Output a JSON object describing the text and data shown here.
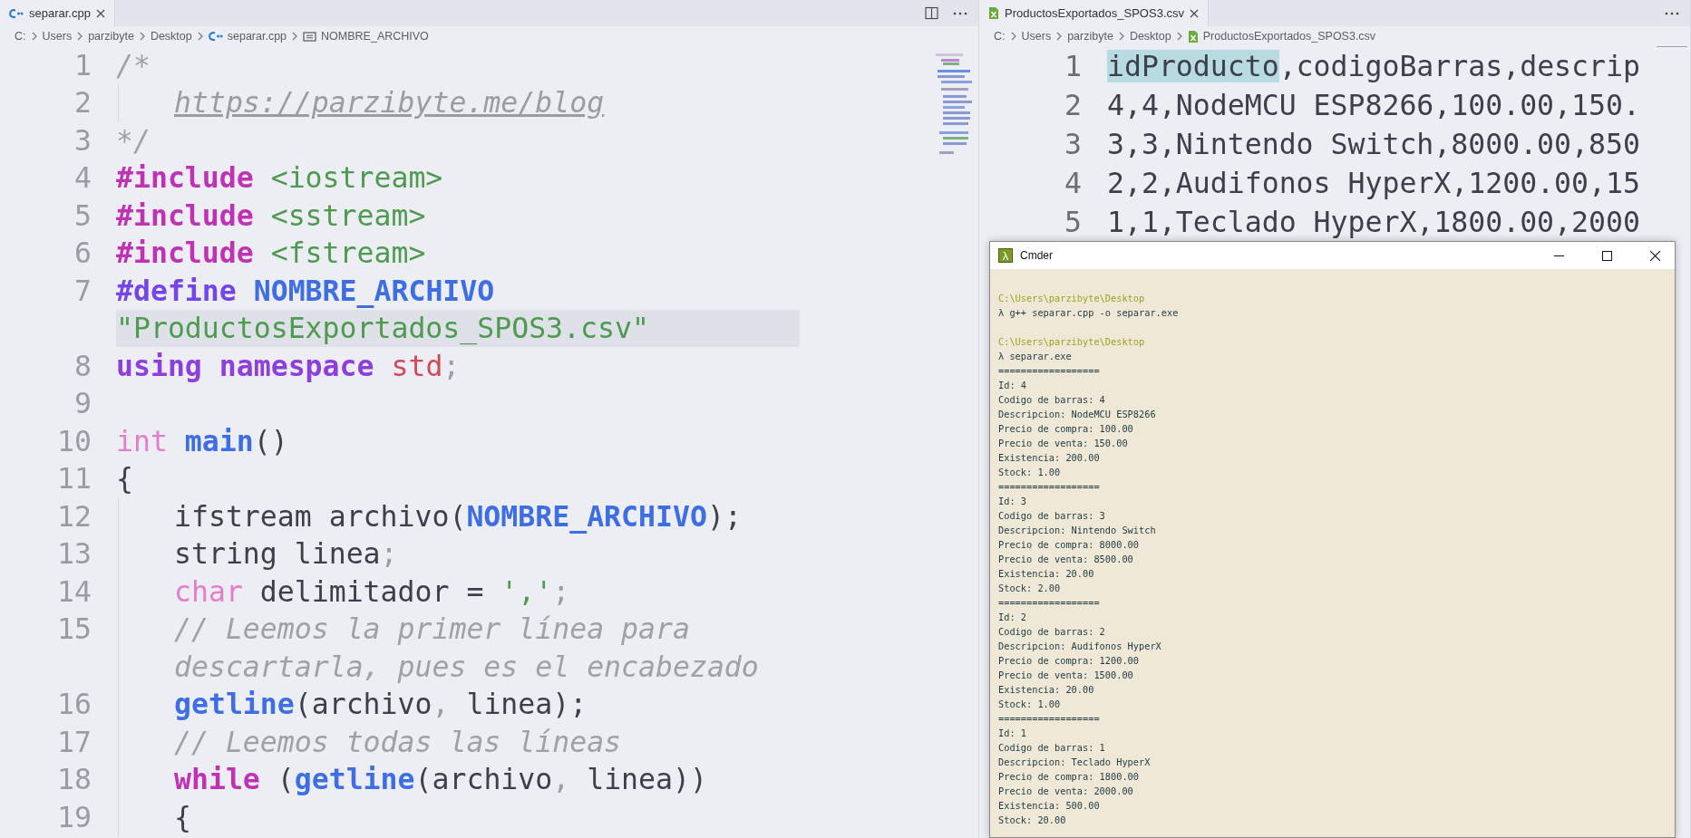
{
  "editor_left": {
    "tab": {
      "label": "separar.cpp",
      "kind": "cpp",
      "selected": true
    },
    "breadcrumb": [
      {
        "text": "C:",
        "kind": "plain"
      },
      {
        "text": "Users",
        "kind": "plain"
      },
      {
        "text": "parzibyte",
        "kind": "plain"
      },
      {
        "text": "Desktop",
        "kind": "plain"
      },
      {
        "text": "separar.cpp",
        "kind": "cpp"
      },
      {
        "text": "NOMBRE_ARCHIVO",
        "kind": "symbol"
      }
    ],
    "code_rows": [
      {
        "number": "1",
        "indented": false,
        "highlighted": false,
        "tokens": [
          {
            "kind": "comment",
            "text": "/*"
          }
        ]
      },
      {
        "number": "2",
        "indented": true,
        "highlighted": false,
        "tokens": [
          {
            "kind": "link",
            "text": "https://parzibyte.me/blog"
          }
        ]
      },
      {
        "number": "3",
        "indented": false,
        "highlighted": false,
        "tokens": [
          {
            "kind": "comment",
            "text": "*/"
          }
        ]
      },
      {
        "number": "4",
        "indented": false,
        "highlighted": false,
        "tokens": [
          {
            "kind": "directive",
            "text": "#include"
          },
          {
            "kind": "header",
            "text": " <iostream>"
          }
        ]
      },
      {
        "number": "5",
        "indented": false,
        "highlighted": false,
        "tokens": [
          {
            "kind": "directive",
            "text": "#include"
          },
          {
            "kind": "header",
            "text": " <sstream>"
          }
        ]
      },
      {
        "number": "6",
        "indented": false,
        "highlighted": false,
        "tokens": [
          {
            "kind": "directive",
            "text": "#include"
          },
          {
            "kind": "header",
            "text": " <fstream>"
          }
        ]
      },
      {
        "number": "7",
        "indented": false,
        "highlighted": false,
        "tokens": [
          {
            "kind": "define",
            "text": "#define"
          },
          {
            "kind": "macro",
            "text": " NOMBRE_ARCHIVO"
          }
        ]
      },
      {
        "indented": false,
        "highlighted": true,
        "tokens": [
          {
            "kind": "string",
            "text": "\"ProductosExportados_SPOS3.csv\""
          }
        ]
      },
      {
        "number": "8",
        "indented": false,
        "highlighted": false,
        "tokens": [
          {
            "kind": "keyword",
            "text": "using namespace"
          },
          {
            "kind": "namespace",
            "text": " std"
          },
          {
            "kind": "punct",
            "text": ";"
          }
        ]
      },
      {
        "number": "9",
        "indented": false,
        "highlighted": false
      },
      {
        "number": "10",
        "indented": false,
        "highlighted": false,
        "tokens": [
          {
            "kind": "type",
            "text": "int"
          },
          {
            "kind": "function",
            "text": " main"
          },
          {
            "kind": "plain",
            "text": "()"
          }
        ]
      },
      {
        "number": "11",
        "indented": false,
        "highlighted": false,
        "tokens": [
          {
            "kind": "plain",
            "text": "{"
          }
        ]
      },
      {
        "number": "12",
        "indented": true,
        "highlighted": false,
        "tokens": [
          {
            "kind": "plain",
            "text": "ifstream archivo("
          },
          {
            "kind": "macro",
            "text": "NOMBRE_ARCHIVO"
          },
          {
            "kind": "plain",
            "text": ");"
          }
        ]
      },
      {
        "number": "13",
        "indented": true,
        "highlighted": false,
        "tokens": [
          {
            "kind": "plain",
            "text": "string linea"
          },
          {
            "kind": "punct",
            "text": ";"
          }
        ]
      },
      {
        "number": "14",
        "indented": true,
        "highlighted": false,
        "tokens": [
          {
            "kind": "type",
            "text": "char"
          },
          {
            "kind": "plain",
            "text": " delimitador = "
          },
          {
            "kind": "string",
            "text": "','"
          },
          {
            "kind": "punct",
            "text": ";"
          }
        ]
      },
      {
        "number": "15",
        "indented": true,
        "highlighted": false,
        "tokens": [
          {
            "kind": "comment",
            "text": "// Leemos la primer línea para"
          }
        ]
      },
      {
        "indented": true,
        "highlighted": false,
        "tokens": [
          {
            "kind": "comment",
            "text": "descartarla, pues es el encabezado"
          }
        ]
      },
      {
        "number": "16",
        "indented": true,
        "highlighted": false,
        "tokens": [
          {
            "kind": "function",
            "text": "getline"
          },
          {
            "kind": "plain",
            "text": "(archivo"
          },
          {
            "kind": "punct",
            "text": ","
          },
          {
            "kind": "plain",
            "text": " linea);"
          }
        ]
      },
      {
        "number": "17",
        "indented": true,
        "highlighted": false,
        "tokens": [
          {
            "kind": "comment",
            "text": "// Leemos todas las líneas"
          }
        ]
      },
      {
        "number": "18",
        "indented": true,
        "highlighted": false,
        "tokens": [
          {
            "kind": "control",
            "text": "while"
          },
          {
            "kind": "plain",
            "text": " ("
          },
          {
            "kind": "function",
            "text": "getline"
          },
          {
            "kind": "plain",
            "text": "(archivo"
          },
          {
            "kind": "punct",
            "text": ","
          },
          {
            "kind": "plain",
            "text": " linea))"
          }
        ]
      },
      {
        "number": "19",
        "indented": true,
        "highlighted": false,
        "tokens": [
          {
            "kind": "plain",
            "text": "{"
          }
        ]
      }
    ]
  },
  "editor_right": {
    "tab": {
      "label": "ProductosExportados_SPOS3.csv",
      "kind": "csv",
      "selected": true
    },
    "breadcrumb": [
      {
        "text": "C:",
        "kind": "plain"
      },
      {
        "text": "Users",
        "kind": "plain"
      },
      {
        "text": "parzibyte",
        "kind": "plain"
      },
      {
        "text": "Desktop",
        "kind": "plain"
      },
      {
        "text": "ProductosExportados_SPOS3.csv",
        "kind": "csv"
      }
    ],
    "csv_rows": [
      {
        "number": "1",
        "parts": [
          {
            "text": "idProducto",
            "highlighted": true
          },
          {
            "text": ",codigoBarras,descrip",
            "highlighted": false
          }
        ]
      },
      {
        "number": "2",
        "parts": [
          {
            "text": "4,4,NodeMCU ESP8266,100.00,150.",
            "highlighted": false
          }
        ]
      },
      {
        "number": "3",
        "parts": [
          {
            "text": "3,3,Nintendo Switch,8000.00,850",
            "highlighted": false
          }
        ]
      },
      {
        "number": "4",
        "parts": [
          {
            "text": "2,2,Audifonos HyperX,1200.00,15",
            "highlighted": false
          }
        ]
      },
      {
        "number": "5",
        "parts": [
          {
            "text": "1,1,Teclado HyperX,1800.00,2000",
            "highlighted": false
          }
        ]
      }
    ]
  },
  "terminal": {
    "icon": "λ",
    "title": "Cmder",
    "lines": [
      {
        "kind": "blank"
      },
      {
        "kind": "path",
        "text": "C:\\Users\\parzibyte\\Desktop"
      },
      {
        "kind": "output",
        "text": "λ g++ separar.cpp -o separar.exe"
      },
      {
        "kind": "blank"
      },
      {
        "kind": "path",
        "text": "C:\\Users\\parzibyte\\Desktop"
      },
      {
        "kind": "output",
        "text": "λ separar.exe"
      },
      {
        "kind": "output",
        "text": "=================="
      },
      {
        "kind": "output",
        "text": "Id: 4"
      },
      {
        "kind": "output",
        "text": "Codigo de barras: 4"
      },
      {
        "kind": "output",
        "text": "Descripcion: NodeMCU ESP8266"
      },
      {
        "kind": "output",
        "text": "Precio de compra: 100.00"
      },
      {
        "kind": "output",
        "text": "Precio de venta: 150.00"
      },
      {
        "kind": "output",
        "text": "Existencia: 200.00"
      },
      {
        "kind": "output",
        "text": "Stock: 1.00"
      },
      {
        "kind": "output",
        "text": "=================="
      },
      {
        "kind": "output",
        "text": "Id: 3"
      },
      {
        "kind": "output",
        "text": "Codigo de barras: 3"
      },
      {
        "kind": "output",
        "text": "Descripcion: Nintendo Switch"
      },
      {
        "kind": "output",
        "text": "Precio de compra: 8000.00"
      },
      {
        "kind": "output",
        "text": "Precio de venta: 8500.00"
      },
      {
        "kind": "output",
        "text": "Existencia: 20.00"
      },
      {
        "kind": "output",
        "text": "Stock: 2.00"
      },
      {
        "kind": "output",
        "text": "=================="
      },
      {
        "kind": "output",
        "text": "Id: 2"
      },
      {
        "kind": "output",
        "text": "Codigo de barras: 2"
      },
      {
        "kind": "output",
        "text": "Descripcion: Audifonos HyperX"
      },
      {
        "kind": "output",
        "text": "Precio de compra: 1200.00"
      },
      {
        "kind": "output",
        "text": "Precio de venta: 1500.00"
      },
      {
        "kind": "output",
        "text": "Existencia: 20.00"
      },
      {
        "kind": "output",
        "text": "Stock: 1.00"
      },
      {
        "kind": "output",
        "text": "=================="
      },
      {
        "kind": "output",
        "text": "Id: 1"
      },
      {
        "kind": "output",
        "text": "Codigo de barras: 1"
      },
      {
        "kind": "output",
        "text": "Descripcion: Teclado HyperX"
      },
      {
        "kind": "output",
        "text": "Precio de compra: 1800.00"
      },
      {
        "kind": "output",
        "text": "Precio de venta: 2000.00"
      },
      {
        "kind": "output",
        "text": "Existencia: 500.00"
      },
      {
        "kind": "output",
        "text": "Stock: 20.00"
      }
    ]
  }
}
